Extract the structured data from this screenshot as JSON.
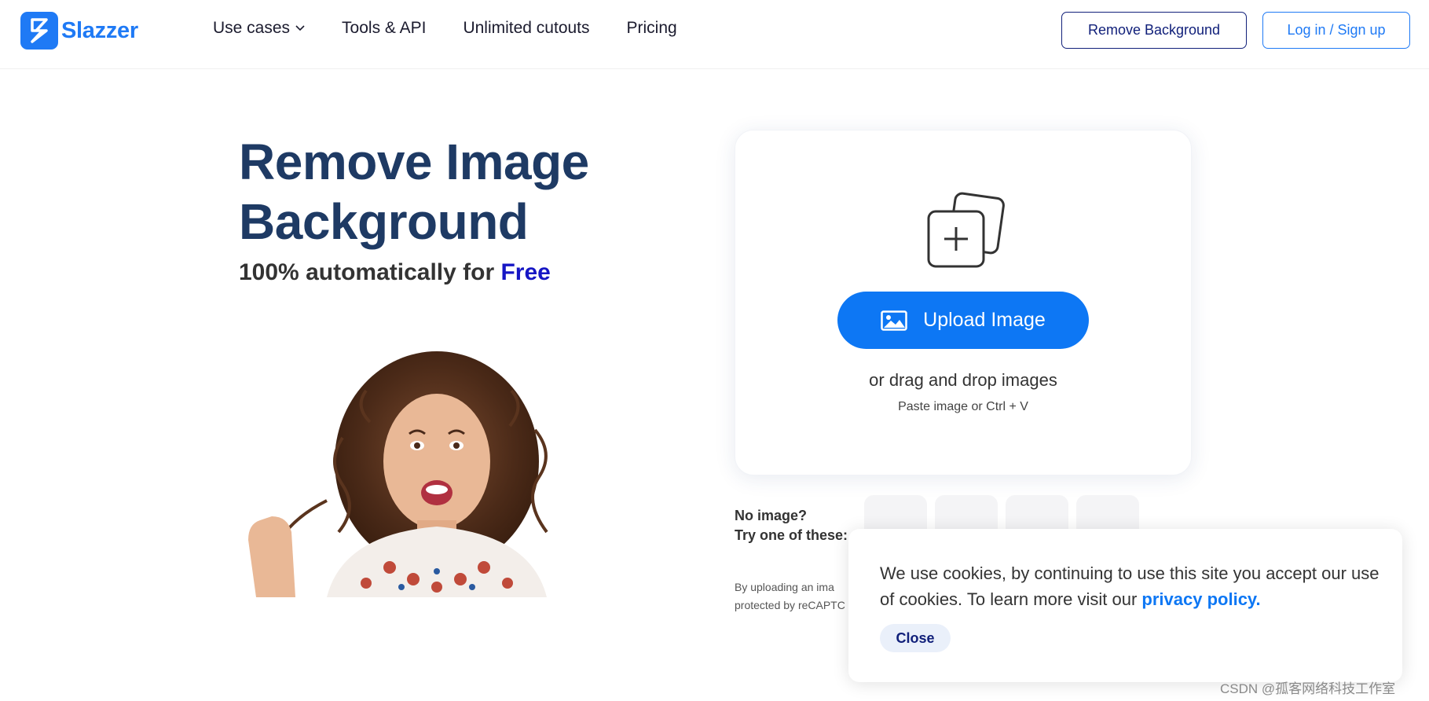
{
  "header": {
    "logo_text": "Slazzer",
    "nav": [
      {
        "label": "Use cases",
        "has_dropdown": true
      },
      {
        "label": "Tools & API"
      },
      {
        "label": "Unlimited cutouts"
      },
      {
        "label": "Pricing"
      }
    ],
    "remove_bg_label": "Remove Background",
    "login_label": "Log in / Sign up"
  },
  "hero": {
    "title_line1": "Remove Image",
    "title_line2": "Background",
    "subtitle_prefix": "100% automatically for",
    "subtitle_highlight": "Free"
  },
  "upload": {
    "button_label": "Upload Image",
    "drag_text": "or drag and drop images",
    "paste_text": "Paste image or Ctrl + V"
  },
  "samples": {
    "line1": "No image?",
    "line2": "Try one of these:",
    "thumb_count": 4
  },
  "legal": {
    "line1": "By uploading an ima",
    "line2": "protected by reCAPTC"
  },
  "cookie": {
    "text": "We use cookies, by continuing to use this site you accept our use of cookies. To learn more visit our",
    "link_text": "privacy policy.",
    "close_label": "Close"
  },
  "watermark": "CSDN @孤客网络科技工作室",
  "colors": {
    "brand_blue": "#1f7af5",
    "upload_blue": "#0d77f4",
    "navy": "#1e3a64",
    "free_blue": "#1616c4",
    "dark_navy_outline": "#11207a"
  },
  "icons": {
    "logo": "slazzer-logo-icon",
    "upload_area": "add-images-icon",
    "upload_button": "image-icon",
    "dropdown": "chevron-down-icon"
  }
}
